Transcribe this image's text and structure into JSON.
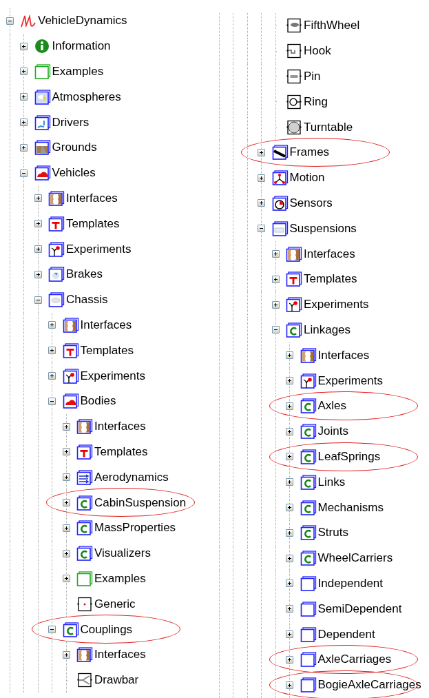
{
  "tree": [
    {
      "label": "VehicleDynamics",
      "kind": "logo",
      "expanded": true,
      "circled": false,
      "children": [
        {
          "label": "Information",
          "kind": "info",
          "expanded": false,
          "circled": false
        },
        {
          "label": "Examples",
          "kind": "examples",
          "expanded": false,
          "circled": false
        },
        {
          "label": "Atmospheres",
          "kind": "atmosphere",
          "expanded": false,
          "circled": false
        },
        {
          "label": "Drivers",
          "kind": "driver",
          "expanded": false,
          "circled": false
        },
        {
          "label": "Grounds",
          "kind": "ground",
          "expanded": false,
          "circled": false
        },
        {
          "label": "Vehicles",
          "kind": "car",
          "expanded": true,
          "circled": false,
          "children": [
            {
              "label": "Interfaces",
              "kind": "interface",
              "expanded": false,
              "circled": false
            },
            {
              "label": "Templates",
              "kind": "template",
              "expanded": false,
              "circled": false
            },
            {
              "label": "Experiments",
              "kind": "experiment",
              "expanded": false,
              "circled": false
            },
            {
              "label": "Brakes",
              "kind": "brake",
              "expanded": false,
              "circled": false
            },
            {
              "label": "Chassis",
              "kind": "chassis",
              "expanded": true,
              "circled": false,
              "children": [
                {
                  "label": "Interfaces",
                  "kind": "interface",
                  "expanded": false,
                  "circled": false
                },
                {
                  "label": "Templates",
                  "kind": "template",
                  "expanded": false,
                  "circled": false
                },
                {
                  "label": "Experiments",
                  "kind": "experiment",
                  "expanded": false,
                  "circled": false
                },
                {
                  "label": "Bodies",
                  "kind": "car",
                  "expanded": true,
                  "circled": false,
                  "children": [
                    {
                      "label": "Interfaces",
                      "kind": "interface",
                      "expanded": false,
                      "circled": false
                    },
                    {
                      "label": "Templates",
                      "kind": "template",
                      "expanded": false,
                      "circled": false
                    },
                    {
                      "label": "Aerodynamics",
                      "kind": "aero",
                      "expanded": false,
                      "circled": false
                    },
                    {
                      "label": "CabinSuspension",
                      "kind": "class",
                      "expanded": false,
                      "circled": true
                    },
                    {
                      "label": "MassProperties",
                      "kind": "class",
                      "expanded": false,
                      "circled": false
                    },
                    {
                      "label": "Visualizers",
                      "kind": "class",
                      "expanded": false,
                      "circled": false
                    },
                    {
                      "label": "Examples",
                      "kind": "examples",
                      "expanded": false,
                      "circled": false
                    },
                    {
                      "label": "Generic",
                      "kind": "generic",
                      "circled": false
                    }
                  ]
                },
                {
                  "label": "Couplings",
                  "kind": "class",
                  "expanded": true,
                  "circled": true,
                  "children": [
                    {
                      "label": "Interfaces",
                      "kind": "interface",
                      "expanded": false,
                      "circled": false
                    },
                    {
                      "label": "Drawbar",
                      "kind": "drawbar",
                      "circled": false
                    },
                    {
                      "label": "FifthWheel",
                      "kind": "fifthwheel",
                      "circled": false,
                      "column_break": true
                    },
                    {
                      "label": "Hook",
                      "kind": "hook",
                      "circled": false
                    },
                    {
                      "label": "Pin",
                      "kind": "pin",
                      "circled": false
                    },
                    {
                      "label": "Ring",
                      "kind": "ring",
                      "circled": false
                    },
                    {
                      "label": "Turntable",
                      "kind": "turntable",
                      "circled": false
                    }
                  ]
                },
                {
                  "label": "Frames",
                  "kind": "frame",
                  "expanded": false,
                  "circled": true
                },
                {
                  "label": "Motion",
                  "kind": "motion",
                  "expanded": false,
                  "circled": false
                },
                {
                  "label": "Sensors",
                  "kind": "sensor",
                  "expanded": false,
                  "circled": false
                },
                {
                  "label": "Suspensions",
                  "kind": "suspension",
                  "expanded": true,
                  "circled": false,
                  "children": [
                    {
                      "label": "Interfaces",
                      "kind": "interface",
                      "expanded": false,
                      "circled": false
                    },
                    {
                      "label": "Templates",
                      "kind": "template",
                      "expanded": false,
                      "circled": false
                    },
                    {
                      "label": "Experiments",
                      "kind": "experiment",
                      "expanded": false,
                      "circled": false
                    },
                    {
                      "label": "Linkages",
                      "kind": "class",
                      "expanded": true,
                      "circled": false,
                      "children": [
                        {
                          "label": "Interfaces",
                          "kind": "interface",
                          "expanded": false,
                          "circled": false
                        },
                        {
                          "label": "Experiments",
                          "kind": "experiment",
                          "expanded": false,
                          "circled": false
                        },
                        {
                          "label": "Axles",
                          "kind": "class",
                          "expanded": false,
                          "circled": true
                        },
                        {
                          "label": "Joints",
                          "kind": "class",
                          "expanded": false,
                          "circled": false
                        },
                        {
                          "label": "LeafSprings",
                          "kind": "class",
                          "expanded": false,
                          "circled": true
                        },
                        {
                          "label": "Links",
                          "kind": "class",
                          "expanded": false,
                          "circled": false
                        },
                        {
                          "label": "Mechanisms",
                          "kind": "class",
                          "expanded": false,
                          "circled": false
                        },
                        {
                          "label": "Struts",
                          "kind": "class",
                          "expanded": false,
                          "circled": false
                        },
                        {
                          "label": "WheelCarriers",
                          "kind": "class",
                          "expanded": false,
                          "circled": false
                        },
                        {
                          "label": "Independent",
                          "kind": "package",
                          "expanded": false,
                          "circled": false
                        },
                        {
                          "label": "SemiDependent",
                          "kind": "package",
                          "expanded": false,
                          "circled": false
                        },
                        {
                          "label": "Dependent",
                          "kind": "package",
                          "expanded": false,
                          "circled": false
                        },
                        {
                          "label": "AxleCarriages",
                          "kind": "package",
                          "expanded": false,
                          "circled": true
                        },
                        {
                          "label": "BogieAxleCarriages",
                          "kind": "package",
                          "expanded": false,
                          "circled": true
                        }
                      ]
                    }
                  ]
                }
              ]
            }
          ]
        }
      ]
    }
  ]
}
